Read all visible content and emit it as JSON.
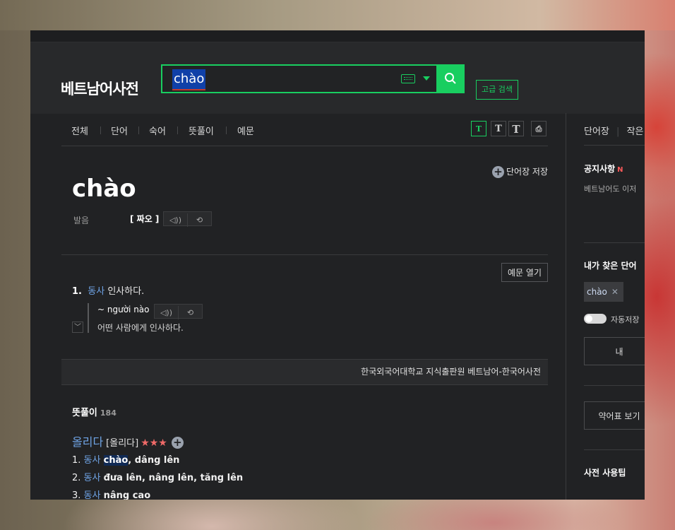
{
  "header": {
    "logo": "베트남어사전",
    "search_value": "chào",
    "advanced_search": "고급 검색"
  },
  "tabs": [
    "전체",
    "단어",
    "숙어",
    "뜻풀이",
    "예문"
  ],
  "font_buttons": [
    "T",
    "T",
    "T"
  ],
  "entry": {
    "word": "chào",
    "save_label": "단어장 저장",
    "pron_label": "발음",
    "pron": "[ 짜오 ]"
  },
  "meaning": {
    "example_open": "예문 열기",
    "number": "1.",
    "pos": "동사",
    "text": "인사하다.",
    "example_vi": "~ người nào",
    "example_ko": "어떤 사람에게 인사하다."
  },
  "source": "한국외국어대학교 지식출판원 베트남어-한국어사전",
  "definitions": {
    "title": "뜻풀이",
    "count": "184",
    "keyword": "올리다",
    "keyword_hanja": "[올리다]",
    "stars": "★★★",
    "lines": [
      {
        "num": "1.",
        "pos": "동사",
        "hl": "chào",
        "rest": ", dâng lên"
      },
      {
        "num": "2.",
        "pos": "동사",
        "hl": "",
        "rest": "đưa lên, nâng lên, tăng lên"
      },
      {
        "num": "3.",
        "pos": "동사",
        "hl": "",
        "rest": "nâng cao"
      }
    ]
  },
  "sidebar": {
    "tab1": "단어장",
    "tab2": "작은",
    "notice_title": "공지사항",
    "notice_new": "N",
    "notice_text": "베트남어도 이저",
    "history_title": "내가 찾은 단어",
    "history_chip": "chào",
    "autosave": "자동저장",
    "box1": "내",
    "box2": "약어표 보기",
    "tips": "사전 사용팁"
  },
  "colors": {
    "accent": "#19ce60",
    "pos": "#6fa4e6",
    "stars": "#ef6a68",
    "bg": "#212224"
  }
}
